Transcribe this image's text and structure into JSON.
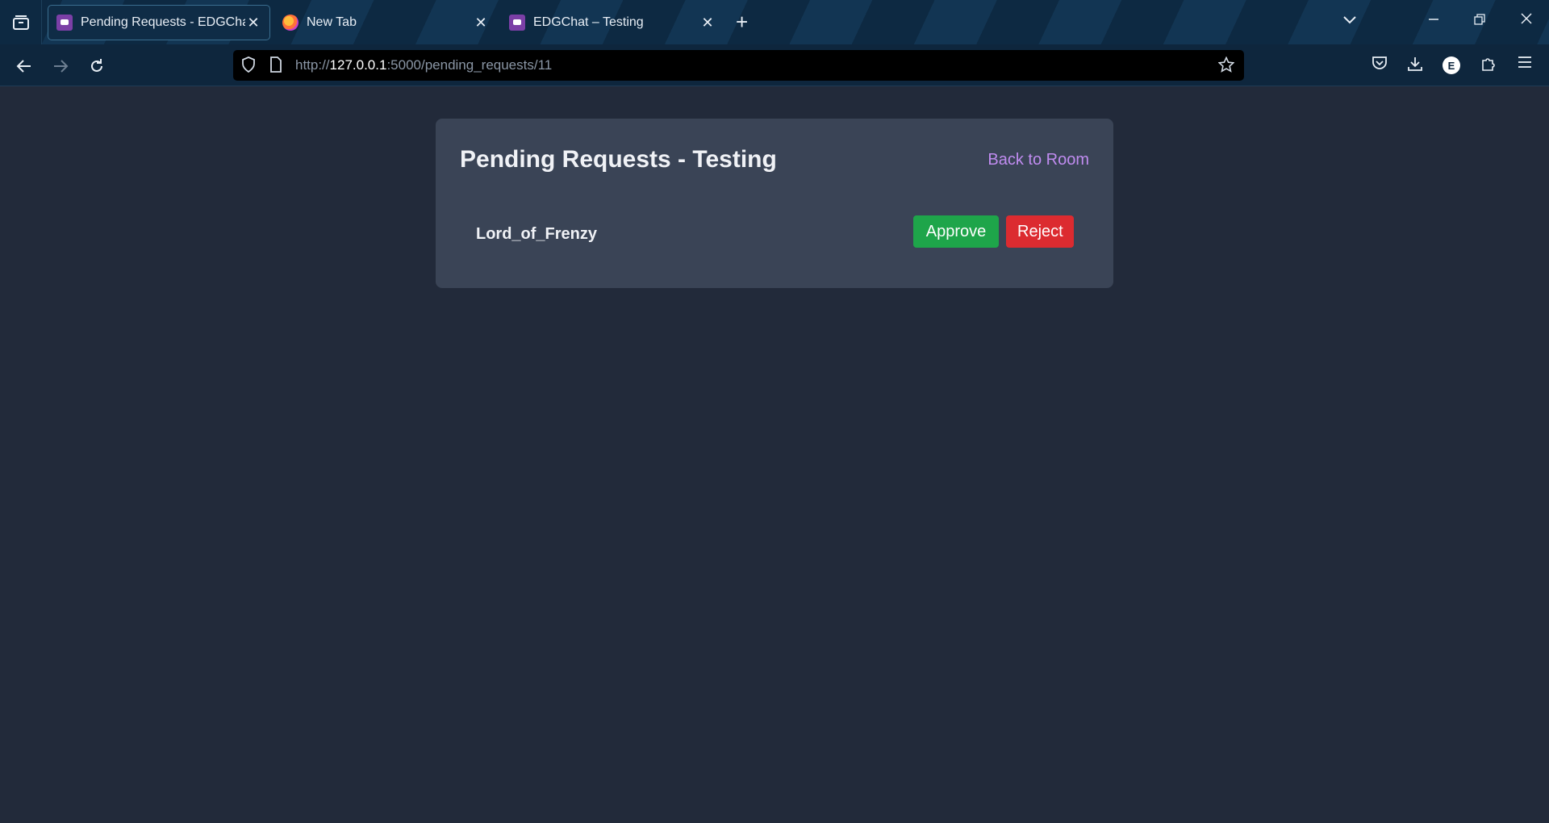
{
  "browser": {
    "tabs": [
      {
        "title": "Pending Requests - EDGChat",
        "icon": "edgchat-favicon",
        "active": true
      },
      {
        "title": "New Tab",
        "icon": "firefox-icon",
        "active": false
      },
      {
        "title": "EDGChat – Testing",
        "icon": "edgchat-favicon",
        "active": false
      }
    ],
    "url": {
      "scheme": "http://",
      "host": "127.0.0.1",
      "rest": ":5000/pending_requests/11"
    },
    "profile_initial": "E"
  },
  "page": {
    "title": "Pending Requests - Testing",
    "back_link": "Back to Room",
    "requests": [
      {
        "username": "Lord_of_Frenzy",
        "approve_label": "Approve",
        "reject_label": "Reject"
      }
    ]
  },
  "colors": {
    "background": "#222a3a",
    "card": "#3a4456",
    "link": "#c08cf0",
    "approve": "#1ea54a",
    "reject": "#dc2b30"
  }
}
